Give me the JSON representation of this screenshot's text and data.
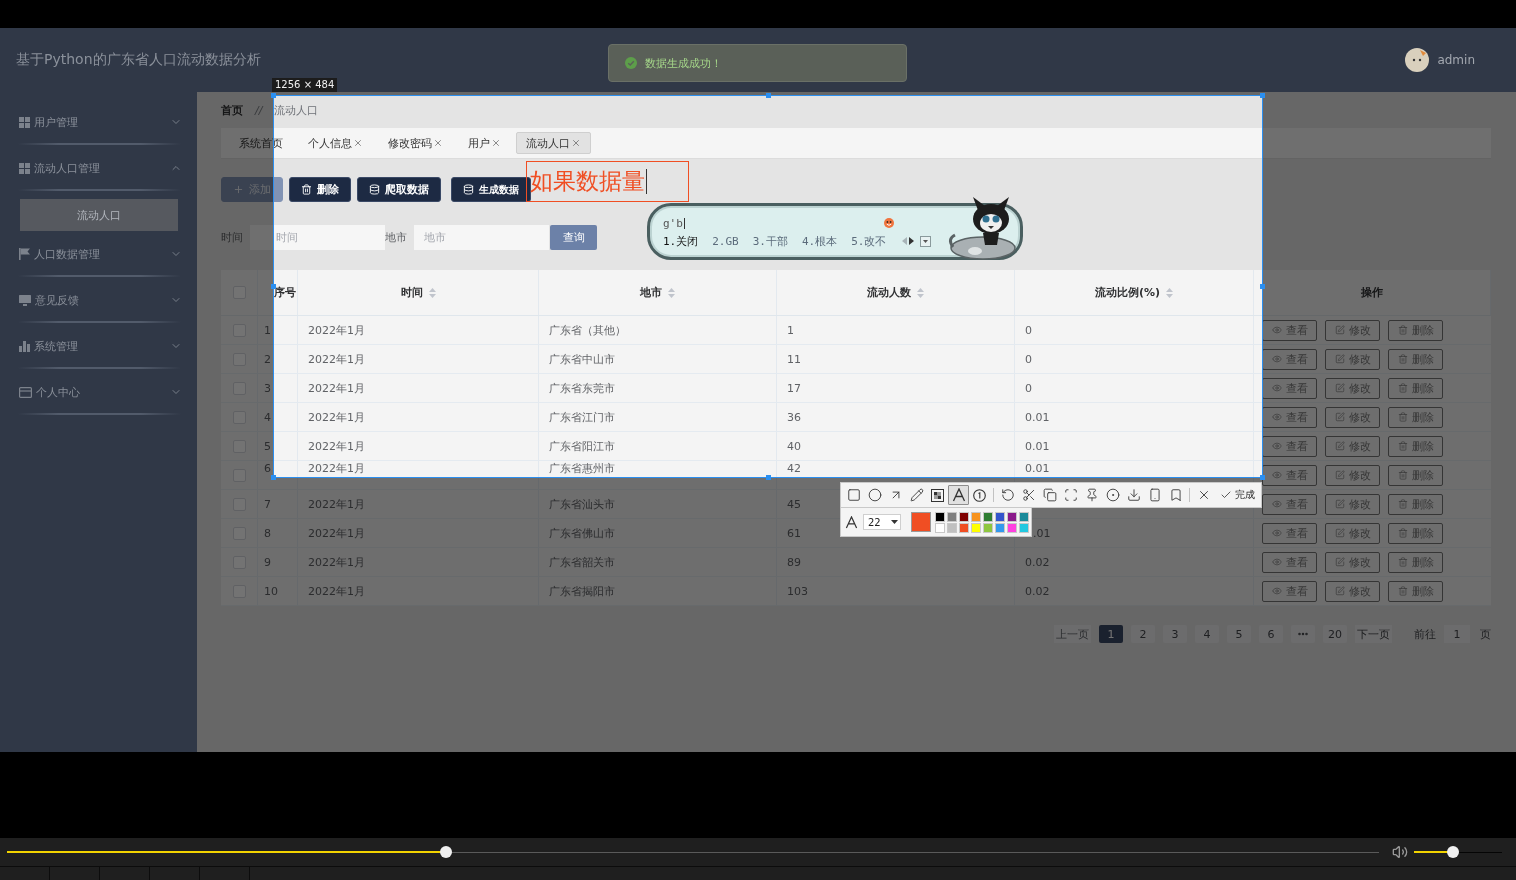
{
  "header": {
    "title": "基于Python的广东省人口流动数据分析",
    "toast": {
      "kind": "success",
      "text": "数据生成成功！"
    },
    "user": {
      "name": "admin"
    }
  },
  "sidebar": {
    "items": [
      {
        "kind": "grid",
        "label": "用户管理",
        "expanded": false
      },
      {
        "kind": "grid",
        "label": "流动人口管理",
        "expanded": true,
        "children": [
          {
            "label": "流动人口",
            "selected": true
          }
        ]
      },
      {
        "kind": "flag",
        "label": "人口数据管理",
        "expanded": false
      },
      {
        "kind": "monitor",
        "label": "意见反馈",
        "expanded": false
      },
      {
        "kind": "chart",
        "label": "系统管理",
        "expanded": false
      },
      {
        "kind": "card",
        "label": "个人中心",
        "expanded": false
      }
    ]
  },
  "breadcrumb": {
    "items": [
      "首页",
      "流动人口"
    ],
    "separator": "//"
  },
  "tabs": [
    {
      "label": "系统首页",
      "closable": false,
      "selected": false
    },
    {
      "label": "个人信息",
      "closable": true,
      "selected": false
    },
    {
      "label": "修改密码",
      "closable": true,
      "selected": false
    },
    {
      "label": "用户",
      "closable": true,
      "selected": false
    },
    {
      "label": "流动人口",
      "closable": true,
      "selected": true
    }
  ],
  "toolbar_buttons": [
    {
      "kind": "add",
      "label": "添加",
      "muted": true
    },
    {
      "kind": "delete",
      "label": "删除",
      "muted": false
    },
    {
      "kind": "crawl",
      "label": "爬取数据",
      "muted": false
    },
    {
      "kind": "generate",
      "label": "生成数据",
      "muted": false
    }
  ],
  "search": {
    "fields": [
      {
        "label": "时间",
        "placeholder": "时间"
      },
      {
        "label": "地市",
        "placeholder": "地市"
      }
    ],
    "button": "查询"
  },
  "table": {
    "all_checked": false,
    "columns": [
      {
        "label": "序号",
        "sortable": false
      },
      {
        "label": "时间",
        "sortable": true
      },
      {
        "label": "地市",
        "sortable": true
      },
      {
        "label": "流动人数",
        "sortable": true
      },
      {
        "label": "流动比例(%)",
        "sortable": true
      },
      {
        "label": "操作",
        "sortable": false
      }
    ],
    "rows": [
      {
        "checked": false,
        "cells": [
          "1",
          "2022年1月",
          "广东省（其他）",
          "1",
          "0"
        ],
        "actions": [
          {
            "kind": "view",
            "label": "查看"
          },
          {
            "kind": "edit",
            "label": "修改"
          },
          {
            "kind": "delete",
            "label": "删除"
          }
        ]
      },
      {
        "checked": false,
        "cells": [
          "2",
          "2022年1月",
          "广东省中山市",
          "11",
          "0"
        ],
        "actions": [
          {
            "kind": "view",
            "label": "查看"
          },
          {
            "kind": "edit",
            "label": "修改"
          },
          {
            "kind": "delete",
            "label": "删除"
          }
        ]
      },
      {
        "checked": false,
        "cells": [
          "3",
          "2022年1月",
          "广东省东莞市",
          "17",
          "0"
        ],
        "actions": [
          {
            "kind": "view",
            "label": "查看"
          },
          {
            "kind": "edit",
            "label": "修改"
          },
          {
            "kind": "delete",
            "label": "删除"
          }
        ]
      },
      {
        "checked": false,
        "cells": [
          "4",
          "2022年1月",
          "广东省江门市",
          "36",
          "0.01"
        ],
        "actions": [
          {
            "kind": "view",
            "label": "查看"
          },
          {
            "kind": "edit",
            "label": "修改"
          },
          {
            "kind": "delete",
            "label": "删除"
          }
        ]
      },
      {
        "checked": false,
        "cells": [
          "5",
          "2022年1月",
          "广东省阳江市",
          "40",
          "0.01"
        ],
        "actions": [
          {
            "kind": "view",
            "label": "查看"
          },
          {
            "kind": "edit",
            "label": "修改"
          },
          {
            "kind": "delete",
            "label": "删除"
          }
        ]
      },
      {
        "checked": false,
        "cells": [
          "6",
          "2022年1月",
          "广东省惠州市",
          "42",
          "0.01"
        ],
        "actions": [
          {
            "kind": "view",
            "label": "查看"
          },
          {
            "kind": "edit",
            "label": "修改"
          },
          {
            "kind": "delete",
            "label": "删除"
          }
        ]
      },
      {
        "checked": false,
        "cells": [
          "7",
          "2022年1月",
          "广东省汕头市",
          "45",
          null
        ],
        "actions": [
          {
            "kind": "view",
            "label": "查看"
          },
          {
            "kind": "edit",
            "label": "修改"
          },
          {
            "kind": "delete",
            "label": "删除"
          }
        ]
      },
      {
        "checked": false,
        "cells": [
          "8",
          "2022年1月",
          "广东省佛山市",
          "61",
          ".01"
        ],
        "actions": [
          {
            "kind": "view",
            "label": "查看"
          },
          {
            "kind": "edit",
            "label": "修改"
          },
          {
            "kind": "delete",
            "label": "删除"
          }
        ]
      },
      {
        "checked": false,
        "cells": [
          "9",
          "2022年1月",
          "广东省韶关市",
          "89",
          "0.02"
        ],
        "actions": [
          {
            "kind": "view",
            "label": "查看"
          },
          {
            "kind": "edit",
            "label": "修改"
          },
          {
            "kind": "delete",
            "label": "删除"
          }
        ]
      },
      {
        "checked": false,
        "cells": [
          "10",
          "2022年1月",
          "广东省揭阳市",
          "103",
          "0.02"
        ],
        "actions": [
          {
            "kind": "view",
            "label": "查看"
          },
          {
            "kind": "edit",
            "label": "修改"
          },
          {
            "kind": "delete",
            "label": "删除"
          }
        ]
      }
    ]
  },
  "pagination": {
    "prev": {
      "label": "上一页",
      "disabled": true
    },
    "pages": [
      {
        "kind": "page",
        "label": "1",
        "selected": true
      },
      {
        "kind": "page",
        "label": "2",
        "selected": false
      },
      {
        "kind": "page",
        "label": "3",
        "selected": false
      },
      {
        "kind": "page",
        "label": "4",
        "selected": false
      },
      {
        "kind": "page",
        "label": "5",
        "selected": false
      },
      {
        "kind": "page",
        "label": "6",
        "selected": false
      },
      {
        "kind": "more",
        "selected": false
      },
      {
        "kind": "page",
        "label": "20",
        "selected": false
      }
    ],
    "next": {
      "label": "下一页",
      "disabled": false
    },
    "jump": {
      "label": "前往",
      "value": "1",
      "suffix": "页"
    }
  },
  "screenshot": {
    "size_label": "1256 × 484",
    "annotation": {
      "text": "如果数据量"
    },
    "tool_groups": [
      [
        {
          "kind": "rectangle",
          "selected": false
        },
        {
          "kind": "ellipse",
          "selected": false
        },
        {
          "kind": "arrow",
          "selected": false
        },
        {
          "kind": "pencil",
          "selected": false
        },
        {
          "kind": "mosaic",
          "selected": false
        },
        {
          "kind": "text",
          "selected": true
        },
        {
          "kind": "counter",
          "selected": false
        }
      ],
      [
        {
          "kind": "undo",
          "selected": false
        },
        {
          "kind": "scissors",
          "selected": false
        },
        {
          "kind": "translate",
          "selected": false
        },
        {
          "kind": "scan",
          "selected": false
        },
        {
          "kind": "pin",
          "selected": false
        },
        {
          "kind": "record",
          "selected": false
        },
        {
          "kind": "download",
          "selected": false
        },
        {
          "kind": "phone",
          "selected": false
        },
        {
          "kind": "bookmark",
          "selected": false
        }
      ],
      [
        {
          "kind": "cancel",
          "selected": false
        },
        {
          "kind": "done",
          "label": "完成",
          "selected": false
        }
      ]
    ],
    "text_size": "22",
    "current": {
      "color": "#f04e23"
    },
    "palette": [
      {
        "color": "#000000"
      },
      {
        "color": "#808080"
      },
      {
        "color": "#800000"
      },
      {
        "color": "#f7931e"
      },
      {
        "color": "#2e7d32"
      },
      {
        "color": "#3355cc"
      },
      {
        "color": "#8b1a8b"
      },
      {
        "color": "#1a8a9a"
      },
      {
        "color": "#ffffff"
      },
      {
        "color": "#c0c0c0"
      },
      {
        "color": "#f04e23"
      },
      {
        "color": "#ffff00"
      },
      {
        "color": "#8dc63f"
      },
      {
        "color": "#3399ee"
      },
      {
        "color": "#ff40e0"
      },
      {
        "color": "#22c8e0"
      }
    ]
  },
  "ime": {
    "composition": "g'b",
    "candidates": [
      {
        "label": "1.关闭",
        "selected": true
      },
      {
        "label": "2.GB",
        "selected": false
      },
      {
        "label": "3.干部",
        "selected": false
      },
      {
        "label": "4.根本",
        "selected": false
      },
      {
        "label": "5.改不",
        "selected": false
      }
    ],
    "prev_disabled": true,
    "next_disabled": false
  },
  "player": {
    "progress": {
      "level": 0.32
    },
    "volume": {
      "level": 0.44
    }
  }
}
